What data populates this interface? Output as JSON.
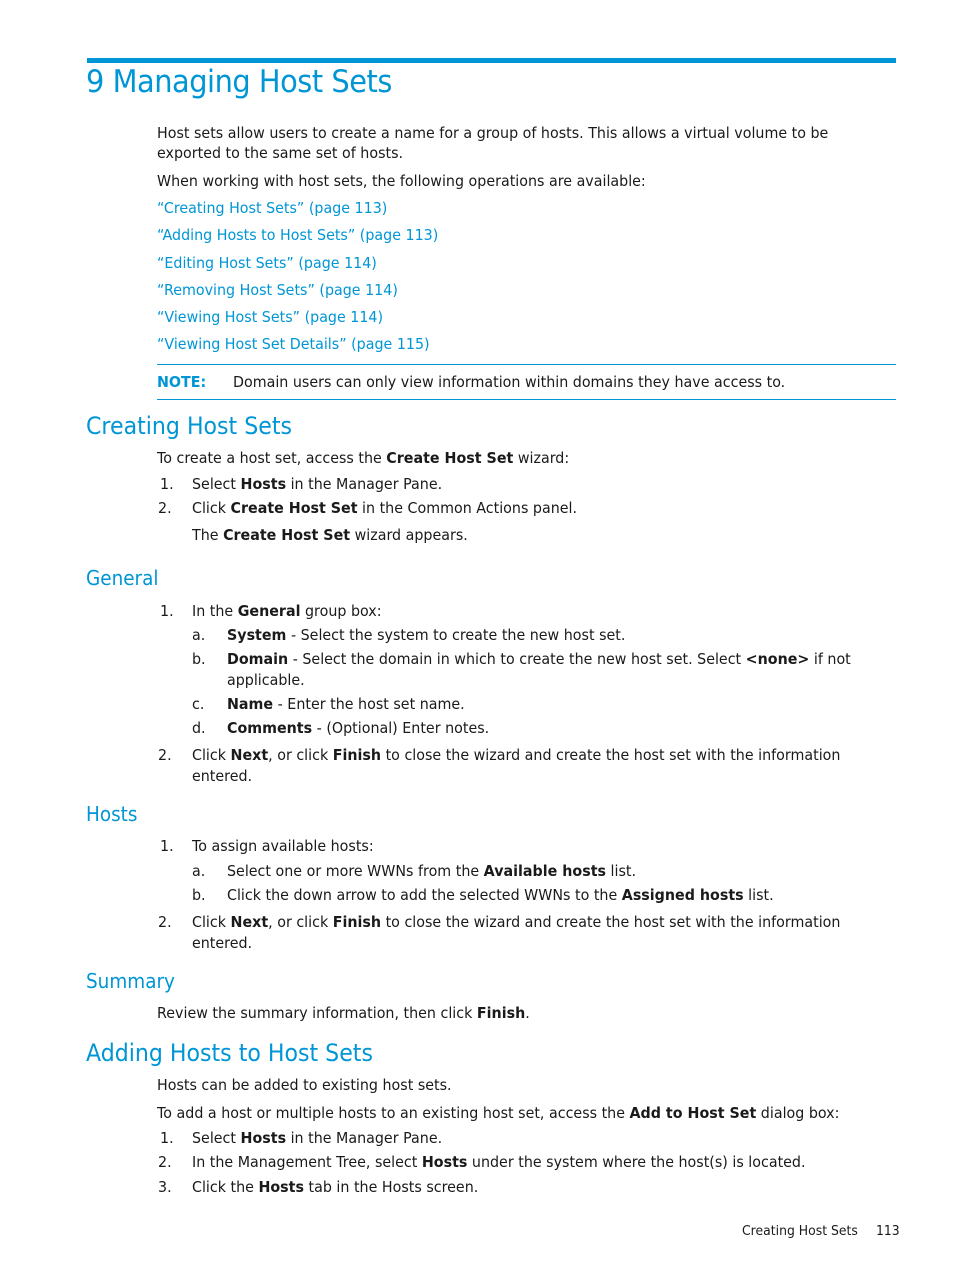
{
  "chapter": {
    "title": "9 Managing Host Sets",
    "intro_line1": "Host sets allow users to create a name for a group of hosts. This allows a virtual volume to be",
    "intro_line2": "exported to the same set of hosts.",
    "operations_intro": "When working with host sets, the following operations are available:",
    "links": [
      "“Creating Host Sets” (page 113)",
      "“Adding Hosts to Host Sets” (page 113)",
      "“Editing Host Sets” (page 114)",
      "“Removing Host Sets” (page 114)",
      "“Viewing Host Sets” (page 114)",
      "“Viewing Host Set Details” (page 115)"
    ],
    "note": {
      "label": "NOTE:",
      "text": "Domain users can only view information within domains they have access to."
    }
  },
  "creating": {
    "heading": "Creating Host Sets",
    "intro_pre": "To create a host set, access the ",
    "intro_bold": "Create Host Set",
    "intro_post": " wizard:",
    "steps": [
      {
        "num": "1.",
        "pre": "Select ",
        "bold": "Hosts",
        "post": " in the Manager Pane."
      },
      {
        "num": "2.",
        "pre": "Click ",
        "bold": "Create Host Set",
        "post": " in the Common Actions panel."
      }
    ],
    "result_pre": "The ",
    "result_bold": "Create Host Set",
    "result_post": " wizard appears."
  },
  "general": {
    "heading": "General",
    "step1": {
      "num": "1.",
      "pre": "In the ",
      "bold": "General",
      "post": " group box:"
    },
    "substeps": [
      {
        "letter": "a.",
        "bold": "System",
        "text": " - Select the system to create the new host set."
      },
      {
        "letter": "b.",
        "bold": "Domain",
        "text": " - Select the domain in which to create the new host set. Select ",
        "bold2": "<none>",
        "text2": " if not",
        "cont": "applicable."
      },
      {
        "letter": "c.",
        "bold": "Name",
        "text": " - Enter the host set name."
      },
      {
        "letter": "d.",
        "bold": "Comments",
        "text": " - (Optional) Enter notes."
      }
    ],
    "step2": {
      "num": "2.",
      "pre": "Click ",
      "bold": "Next",
      "mid": ", or click ",
      "bold2": "Finish",
      "post": " to close the wizard and create the host set with the information",
      "cont": "entered."
    }
  },
  "hosts": {
    "heading": "Hosts",
    "step1": {
      "num": "1.",
      "text": "To assign available hosts:"
    },
    "substeps": [
      {
        "letter": "a.",
        "pre": "Select one or more WWNs from the ",
        "bold": "Available hosts",
        "post": " list."
      },
      {
        "letter": "b.",
        "pre": "Click the down arrow to add the selected WWNs to the ",
        "bold": "Assigned hosts",
        "post": " list."
      }
    ],
    "step2": {
      "num": "2.",
      "pre": "Click ",
      "bold": "Next",
      "mid": ", or click ",
      "bold2": "Finish",
      "post": " to close the wizard and create the host set with the information",
      "cont": "entered."
    }
  },
  "summary": {
    "heading": "Summary",
    "pre": "Review the summary information, then click ",
    "bold": "Finish",
    "post": "."
  },
  "adding": {
    "heading": "Adding Hosts to Host Sets",
    "intro1": "Hosts can be added to existing host sets.",
    "intro2_pre": "To add a host or multiple hosts to an existing host set, access the ",
    "intro2_bold": "Add to Host Set",
    "intro2_post": " dialog box:",
    "steps": [
      {
        "num": "1.",
        "pre": "Select ",
        "bold": "Hosts",
        "post": " in the Manager Pane."
      },
      {
        "num": "2.",
        "pre": "In the Management Tree, select ",
        "bold": "Hosts",
        "post": " under the system where the host(s) is located."
      },
      {
        "num": "3.",
        "pre": "Click the ",
        "bold": "Hosts",
        "post": " tab in the Hosts screen."
      }
    ]
  },
  "footer": {
    "section": "Creating Host Sets",
    "page": "113"
  }
}
